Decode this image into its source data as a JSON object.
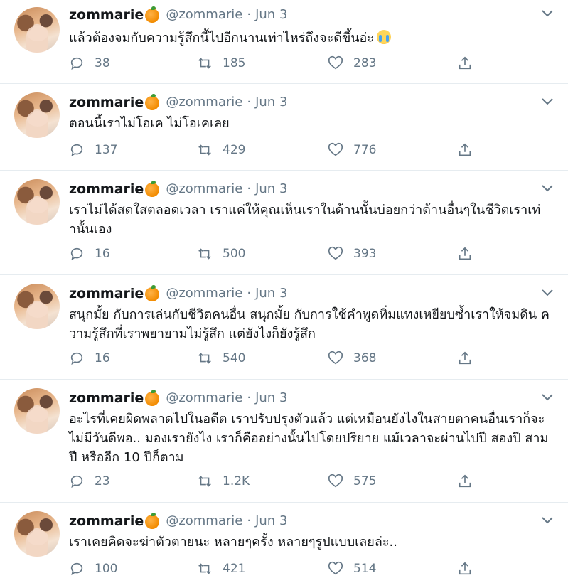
{
  "colors": {
    "text": "#14171a",
    "muted": "#657786",
    "divider": "#e6ecf0",
    "accent_orange": "#f28b00"
  },
  "icons": {
    "reply": "reply-icon",
    "retweet": "retweet-icon",
    "like": "like-icon",
    "share": "share-icon",
    "menu": "chevron-down-icon",
    "name_emoji": "orange-emoji",
    "crying_emoji": "loudly-crying-face-emoji"
  },
  "tweets": [
    {
      "name": "zommarie",
      "handle": "@zommarie",
      "separator": "·",
      "date": "Jun 3",
      "text": "แล้วต้องจมกับความรู้สึกนี้ไปอีกนานเท่าไหร่ถึงจะดีขึ้นอ่ะ",
      "replies": "38",
      "retweets": "185",
      "likes": "283"
    },
    {
      "name": "zommarie",
      "handle": "@zommarie",
      "separator": "·",
      "date": "Jun 3",
      "text": "ตอนนี้เราไม่โอเค ไม่โอเคเลย",
      "replies": "137",
      "retweets": "429",
      "likes": "776"
    },
    {
      "name": "zommarie",
      "handle": "@zommarie",
      "separator": "·",
      "date": "Jun 3",
      "text": "เราไม่ได้สดใสตลอดเวลา เราแค่ให้คุณเห็นเราในด้านนั้นบ่อยกว่าด้านอื่นๆในชีวิตเราเท่านั้นเอง",
      "replies": "16",
      "retweets": "500",
      "likes": "393"
    },
    {
      "name": "zommarie",
      "handle": "@zommarie",
      "separator": "·",
      "date": "Jun 3",
      "text": "สนุกมั้ย กับการเล่นกับชีวิตคนอื่น สนุกมั้ย กับการใช้คำพูดทิ่มแทงเหยียบซ้ำเราให้จมดิน ความรู้สึกที่เราพยายามไม่รู้สึก แต่ยังไงก็ยังรู้สึก",
      "replies": "16",
      "retweets": "540",
      "likes": "368"
    },
    {
      "name": "zommarie",
      "handle": "@zommarie",
      "separator": "·",
      "date": "Jun 3",
      "text": "อะไรที่เคยผิดพลาดไปในอดีต เราปรับปรุงตัวแล้ว แต่เหมือนยังไงในสายตาคนอื่นเราก็จะไม่มีวันดีพอ.. มองเรายังไง เราก็คืออย่างนั้นไปโดยปริยาย แม้เวลาจะผ่านไปปี สองปี สามปี หรืออีก 10 ปีก็ตาม",
      "replies": "23",
      "retweets": "1.2K",
      "likes": "575"
    },
    {
      "name": "zommarie",
      "handle": "@zommarie",
      "separator": "·",
      "date": "Jun 3",
      "text": "เราเคยคิดจะฆ่าตัวตายนะ หลายๆครั้ง หลายๆรูปแบบเลยล่ะ..",
      "replies": "100",
      "retweets": "421",
      "likes": "514"
    }
  ]
}
